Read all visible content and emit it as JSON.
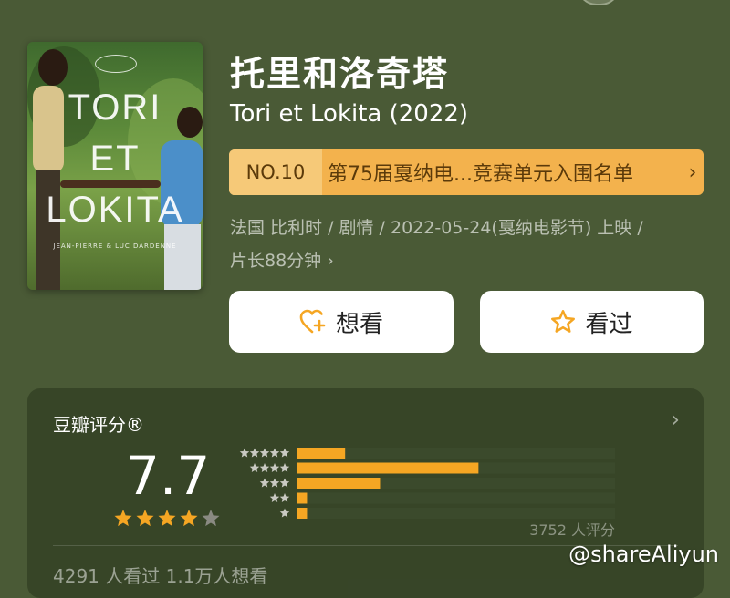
{
  "movie": {
    "title_cn": "托里和洛奇塔",
    "title_original": "Tori et Lokita (2022)",
    "poster": {
      "title_lines": [
        "TORI",
        "ET",
        "LOKITA"
      ],
      "credits": "JEAN-PIERRE & LUC DARDENNE"
    }
  },
  "ranking": {
    "number": "NO.10",
    "list_name": "第75届戛纳电...竞赛单元入围名单",
    "chevron": "›"
  },
  "meta": {
    "line1": "法国 比利时 / 剧情 / 2022-05-24(戛纳电影节) 上映 /",
    "line2": "片长88分钟",
    "chevron": "›"
  },
  "actions": {
    "want": {
      "label": "想看",
      "icon": "heart-plus-icon"
    },
    "seen": {
      "label": "看过",
      "icon": "star-outline-icon"
    }
  },
  "rating": {
    "title": "豆瓣评分®",
    "chevron": "›",
    "score": "7.7",
    "stars_filled": 4,
    "stars_total": 5,
    "distribution": [
      {
        "stars": 5,
        "fraction": 0.15
      },
      {
        "stars": 4,
        "fraction": 0.57
      },
      {
        "stars": 3,
        "fraction": 0.26
      },
      {
        "stars": 2,
        "fraction": 0.03
      },
      {
        "stars": 1,
        "fraction": 0.03
      }
    ],
    "count_text": "3752 人评分",
    "stats_text": "4291 人看过   1.1万人想看"
  },
  "watermark": "@shareAliyun",
  "colors": {
    "background": "#4a5a36",
    "accent_orange": "#f5a623",
    "banner": "#f3b24d",
    "bar_track": "#3b4a2c",
    "star_gray": "#8a8a82"
  }
}
